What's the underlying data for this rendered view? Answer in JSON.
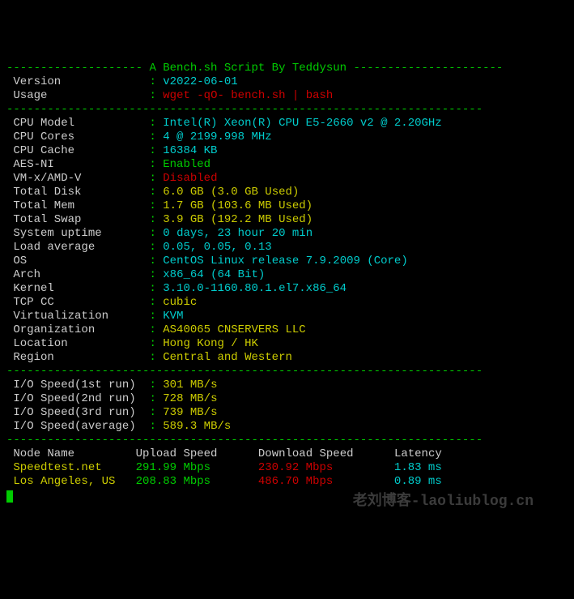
{
  "header": {
    "title": "A Bench.sh Script By Teddysun",
    "version_label": " Version",
    "version_value": "v2022-06-01",
    "usage_label": " Usage",
    "usage_value": "wget -qO- bench.sh | bash"
  },
  "system": {
    "cpu_model_label": " CPU Model",
    "cpu_model_value": "Intel(R) Xeon(R) CPU E5-2660 v2 @ 2.20GHz",
    "cpu_cores_label": " CPU Cores",
    "cpu_cores_value": "4 @ 2199.998 MHz",
    "cpu_cache_label": " CPU Cache",
    "cpu_cache_value": "16384 KB",
    "aesni_label": " AES-NI",
    "aesni_value": "Enabled",
    "vmx_label": " VM-x/AMD-V",
    "vmx_value": "Disabled",
    "disk_label": " Total Disk",
    "disk_value": "6.0 GB (3.0 GB Used)",
    "mem_label": " Total Mem",
    "mem_value": "1.7 GB (103.6 MB Used)",
    "swap_label": " Total Swap",
    "swap_value": "3.9 GB (192.2 MB Used)",
    "uptime_label": " System uptime",
    "uptime_value": "0 days, 23 hour 20 min",
    "load_label": " Load average",
    "load_value": "0.05, 0.05, 0.13",
    "os_label": " OS",
    "os_value": "CentOS Linux release 7.9.2009 (Core)",
    "arch_label": " Arch",
    "arch_value": "x86_64 (64 Bit)",
    "kernel_label": " Kernel",
    "kernel_value": "3.10.0-1160.80.1.el7.x86_64",
    "tcpcc_label": " TCP CC",
    "tcpcc_value": "cubic",
    "virt_label": " Virtualization",
    "virt_value": "KVM",
    "org_label": " Organization",
    "org_value": "AS40065 CNSERVERS LLC",
    "location_label": " Location",
    "location_value": "Hong Kong / HK",
    "region_label": " Region",
    "region_value": "Central and Western"
  },
  "io": {
    "r1_label": " I/O Speed(1st run)",
    "r1_value": "301 MB/s",
    "r2_label": " I/O Speed(2nd run)",
    "r2_value": "728 MB/s",
    "r3_label": " I/O Speed(3rd run)",
    "r3_value": "739 MB/s",
    "avg_label": " I/O Speed(average)",
    "avg_value": "589.3 MB/s"
  },
  "speedtest": {
    "h_node": " Node Name",
    "h_up": "Upload Speed",
    "h_down": "Download Speed",
    "h_lat": "Latency",
    "r1_node": " Speedtest.net",
    "r1_up": "291.99 Mbps",
    "r1_down": "230.92 Mbps",
    "r1_lat": "1.83 ms",
    "r2_node": " Los Angeles, US",
    "r2_up": "208.83 Mbps",
    "r2_down": "486.70 Mbps",
    "r2_lat": "0.89 ms"
  },
  "divider": {
    "sep": " : ",
    "dash_title_l": "-------------------- ",
    "dash_title_r": " ----------------------",
    "dash_full": "----------------------------------------------------------------------"
  },
  "watermark": "老刘博客-laoliublog.cn"
}
